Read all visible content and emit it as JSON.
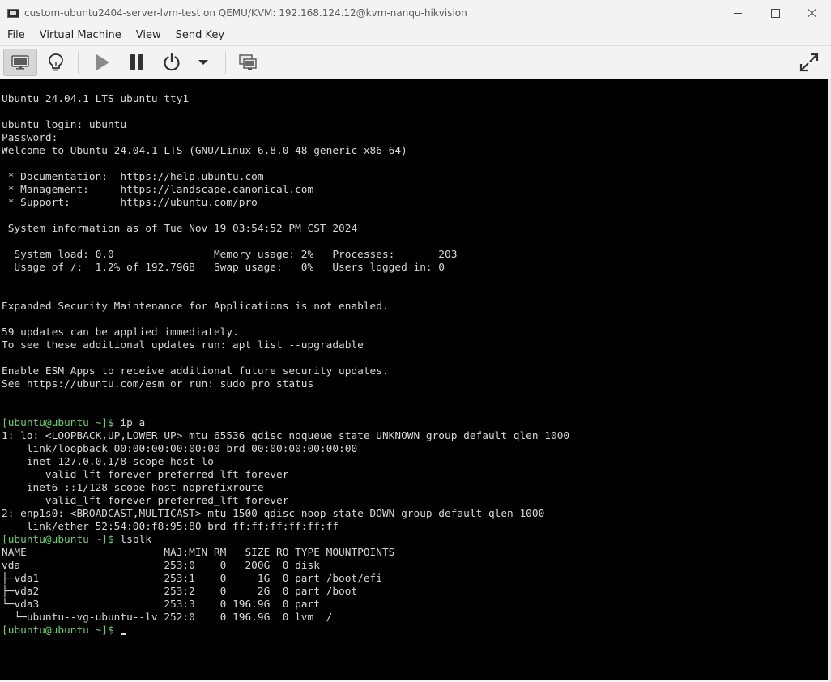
{
  "window": {
    "title": "custom-ubuntu2404-server-lvm-test on QEMU/KVM: 192.168.124.12@kvm-nanqu-hikvision"
  },
  "menu": [
    "File",
    "Virtual Machine",
    "View",
    "Send Key"
  ],
  "toolbar": {
    "icons": [
      "monitor-icon",
      "lightbulb-icon",
      "play-icon",
      "pause-icon",
      "power-icon",
      "dropdown-arrow-icon",
      "screens-icon",
      "fullscreen-icon"
    ]
  },
  "terminal": {
    "prompt": "[ubuntu@ubuntu ~]$",
    "lines": [
      {
        "t": "Ubuntu 24.04.1 LTS ubuntu tty1"
      },
      {
        "t": ""
      },
      {
        "t": "ubuntu login: ubuntu"
      },
      {
        "t": "Password:"
      },
      {
        "t": "Welcome to Ubuntu 24.04.1 LTS (GNU/Linux 6.8.0-48-generic x86_64)"
      },
      {
        "t": ""
      },
      {
        "t": " * Documentation:  https://help.ubuntu.com"
      },
      {
        "t": " * Management:     https://landscape.canonical.com"
      },
      {
        "t": " * Support:        https://ubuntu.com/pro"
      },
      {
        "t": ""
      },
      {
        "t": " System information as of Tue Nov 19 03:54:52 PM CST 2024"
      },
      {
        "t": ""
      },
      {
        "t": "  System load: 0.0                Memory usage: 2%   Processes:       203"
      },
      {
        "t": "  Usage of /:  1.2% of 192.79GB   Swap usage:   0%   Users logged in: 0"
      },
      {
        "t": ""
      },
      {
        "t": ""
      },
      {
        "t": "Expanded Security Maintenance for Applications is not enabled."
      },
      {
        "t": ""
      },
      {
        "t": "59 updates can be applied immediately."
      },
      {
        "t": "To see these additional updates run: apt list --upgradable"
      },
      {
        "t": ""
      },
      {
        "t": "Enable ESM Apps to receive additional future security updates."
      },
      {
        "t": "See https://ubuntu.com/esm or run: sudo pro status"
      },
      {
        "t": ""
      },
      {
        "t": ""
      },
      {
        "p": true,
        "t": " ip a"
      },
      {
        "t": "1: lo: <LOOPBACK,UP,LOWER_UP> mtu 65536 qdisc noqueue state UNKNOWN group default qlen 1000"
      },
      {
        "t": "    link/loopback 00:00:00:00:00:00 brd 00:00:00:00:00:00"
      },
      {
        "t": "    inet 127.0.0.1/8 scope host lo"
      },
      {
        "t": "       valid_lft forever preferred_lft forever"
      },
      {
        "t": "    inet6 ::1/128 scope host noprefixroute"
      },
      {
        "t": "       valid_lft forever preferred_lft forever"
      },
      {
        "t": "2: enp1s0: <BROADCAST,MULTICAST> mtu 1500 qdisc noop state DOWN group default qlen 1000"
      },
      {
        "t": "    link/ether 52:54:00:f8:95:80 brd ff:ff:ff:ff:ff:ff"
      },
      {
        "p": true,
        "t": " lsblk"
      },
      {
        "t": "NAME                      MAJ:MIN RM   SIZE RO TYPE MOUNTPOINTS"
      },
      {
        "t": "vda                       253:0    0   200G  0 disk"
      },
      {
        "t": "├─vda1                    253:1    0     1G  0 part /boot/efi"
      },
      {
        "t": "├─vda2                    253:2    0     2G  0 part /boot"
      },
      {
        "t": "└─vda3                    253:3    0 196.9G  0 part"
      },
      {
        "t": "  └─ubuntu--vg-ubuntu--lv 252:0    0 196.9G  0 lvm  /"
      },
      {
        "p": true,
        "t": " ",
        "c": true
      }
    ]
  }
}
